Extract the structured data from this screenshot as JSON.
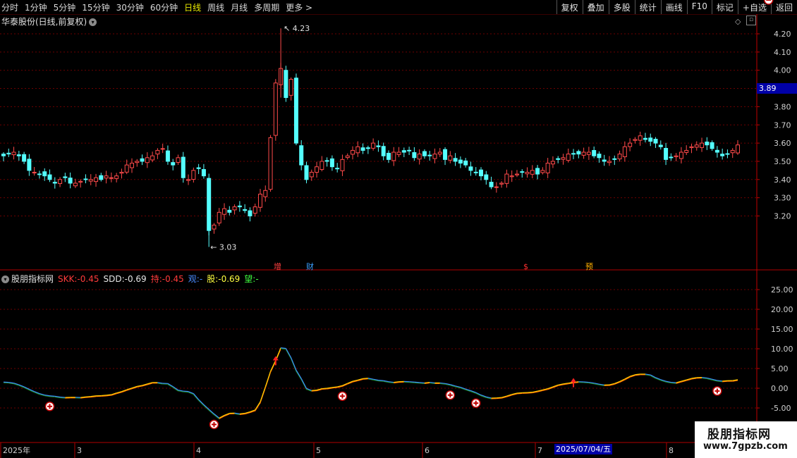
{
  "toolbar": {
    "left_items": [
      "分时",
      "1分钟",
      "5分钟",
      "15分钟",
      "30分钟",
      "60分钟",
      "日线",
      "周线",
      "月线",
      "多周期",
      "更多 >"
    ],
    "active_item": "日线",
    "right_items": [
      "复权",
      "叠加",
      "多股",
      "统计",
      "画线",
      "F10",
      "标记",
      "+自选",
      "返回"
    ]
  },
  "main_chart": {
    "title": "华泰股份(日线,前复权)",
    "y_ticks": [
      "4.20",
      "4.10",
      "4.00",
      "3.90",
      "3.80",
      "3.70",
      "3.60",
      "3.50",
      "3.40",
      "3.30",
      "3.20"
    ],
    "current_price": "3.89",
    "high_label": "4.23",
    "low_label": "3.03",
    "event_markers": [
      {
        "label": "增",
        "color": "#ff4040"
      },
      {
        "label": "财",
        "color": "#3aa0ff"
      },
      {
        "label": "$",
        "color": "#ff3030"
      },
      {
        "label": "预",
        "color": "#ffb000"
      }
    ],
    "colors": {
      "up": "#ff4a4a",
      "down": "#54ffff",
      "grid": "#6e0000",
      "axis": "#c00000"
    }
  },
  "indicator": {
    "name": "股朋指标网",
    "values": [
      {
        "label": "SKK:",
        "value": "-0.45",
        "color": "#ff3b3b"
      },
      {
        "label": "SDD:",
        "value": "-0.69",
        "color": "#e8e8e8"
      },
      {
        "label": "持:",
        "value": "-0.45",
        "color": "#ff3b3b"
      },
      {
        "label": "观:",
        "value": "-",
        "color": "#4a8cff"
      },
      {
        "label": "股:",
        "value": "-0.69",
        "color": "#ffff40"
      },
      {
        "label": "望:",
        "value": "-",
        "color": "#40ff40"
      }
    ],
    "y_ticks": [
      "25.00",
      "20.00",
      "15.00",
      "10.00",
      "5.00",
      "0.00",
      "-5.00"
    ]
  },
  "x_axis": {
    "labels": [
      "2025年",
      "3",
      "4",
      "5",
      "6",
      "7",
      "8"
    ],
    "cursor_date": "2025/07/04/五"
  },
  "watermark": {
    "line1": "股朋指标网",
    "line2": "www.7gpzb.com"
  }
}
